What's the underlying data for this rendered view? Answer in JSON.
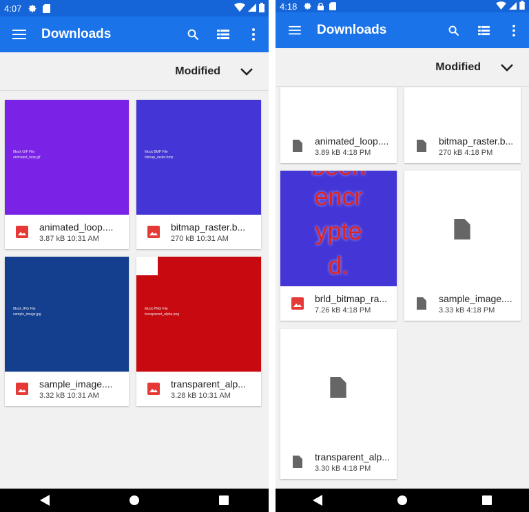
{
  "colors": {
    "appbar": "#1a73e8",
    "statusbar": "#1565d8",
    "purple": "#7a22e6",
    "indigo": "#4435d6",
    "navy": "#143f8f",
    "red": "#c80a10",
    "image_icon": "#e53935",
    "file_icon": "#666666"
  },
  "left": {
    "status": {
      "time": "4:07"
    },
    "appbar": {
      "title": "Downloads"
    },
    "sort": {
      "label": "Modified"
    },
    "files": [
      {
        "name": "animated_loop....",
        "info": "3.87 kB 10:31 AM",
        "thumb_line1": "Mock GIF File",
        "thumb_line2": "animated_loop.gif"
      },
      {
        "name": "bitmap_raster.b...",
        "info": "270 kB 10:31 AM",
        "thumb_line1": "Mock BMP File",
        "thumb_line2": "bitmap_raster.bmp"
      },
      {
        "name": "sample_image....",
        "info": "3.32 kB 10:31 AM",
        "thumb_line1": "Mock JPG File",
        "thumb_line2": "sample_image.jpg"
      },
      {
        "name": "transparent_alp...",
        "info": "3.28 kB 10:31 AM",
        "thumb_line1": "Mock PNG File",
        "thumb_line2": "transparent_alpha.png"
      }
    ]
  },
  "right": {
    "status": {
      "time": "4:18"
    },
    "appbar": {
      "title": "Downloads"
    },
    "sort": {
      "label": "Modified"
    },
    "files": [
      {
        "name": "animated_loop....",
        "info": "3.89 kB 4:18 PM"
      },
      {
        "name": "bitmap_raster.b...",
        "info": "270 kB 4:18 PM"
      },
      {
        "name": "brld_bitmap_ra...",
        "info": "7.26 kB 4:18 PM",
        "thumb_lines": [
          "been",
          "encr",
          "ypte",
          "d."
        ]
      },
      {
        "name": "sample_image....",
        "info": "3.33 kB 4:18 PM"
      },
      {
        "name": "transparent_alp...",
        "info": "3.30 kB 4:18 PM"
      }
    ]
  }
}
